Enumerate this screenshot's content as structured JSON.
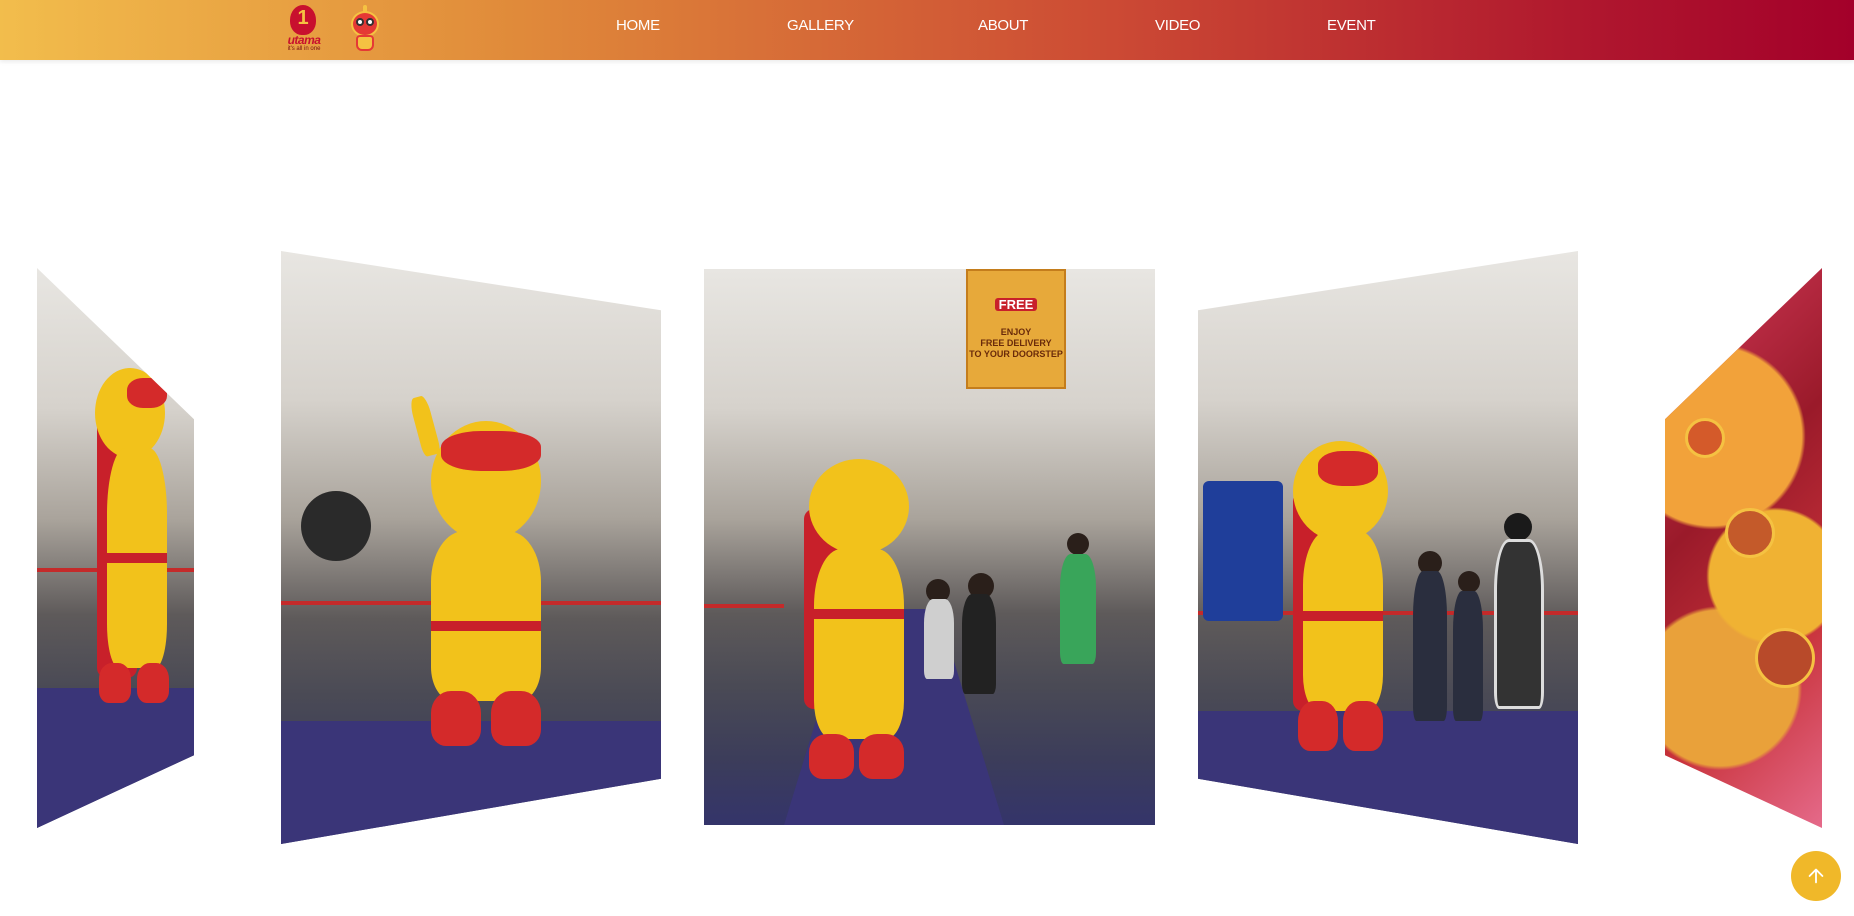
{
  "brand": {
    "logo_text": "1",
    "logo_word": "utama",
    "logo_tagline": "it's all in one",
    "mascot_logo": "mascot-icon"
  },
  "nav": {
    "items": [
      {
        "label": "HOME"
      },
      {
        "label": "GALLERY"
      },
      {
        "label": "ABOUT"
      },
      {
        "label": "VIDEO"
      },
      {
        "label": "EVENT"
      }
    ]
  },
  "gallery": {
    "slides": [
      {
        "subject": "mascot-photo"
      },
      {
        "subject": "mascot-photo"
      },
      {
        "subject": "mascot-photo"
      },
      {
        "subject": "mascot-photo"
      },
      {
        "subject": "balloon-photo"
      }
    ],
    "banner": {
      "line1": "FREE",
      "line2": "ENJOY",
      "line3": "FREE DELIVERY",
      "line4": "TO YOUR DOORSTEP"
    }
  },
  "scroll_top": {
    "icon": "arrow-up-icon"
  },
  "colors": {
    "header_start": "#f2bd4c",
    "header_end": "#a3002a",
    "accent": "#f0b829"
  }
}
